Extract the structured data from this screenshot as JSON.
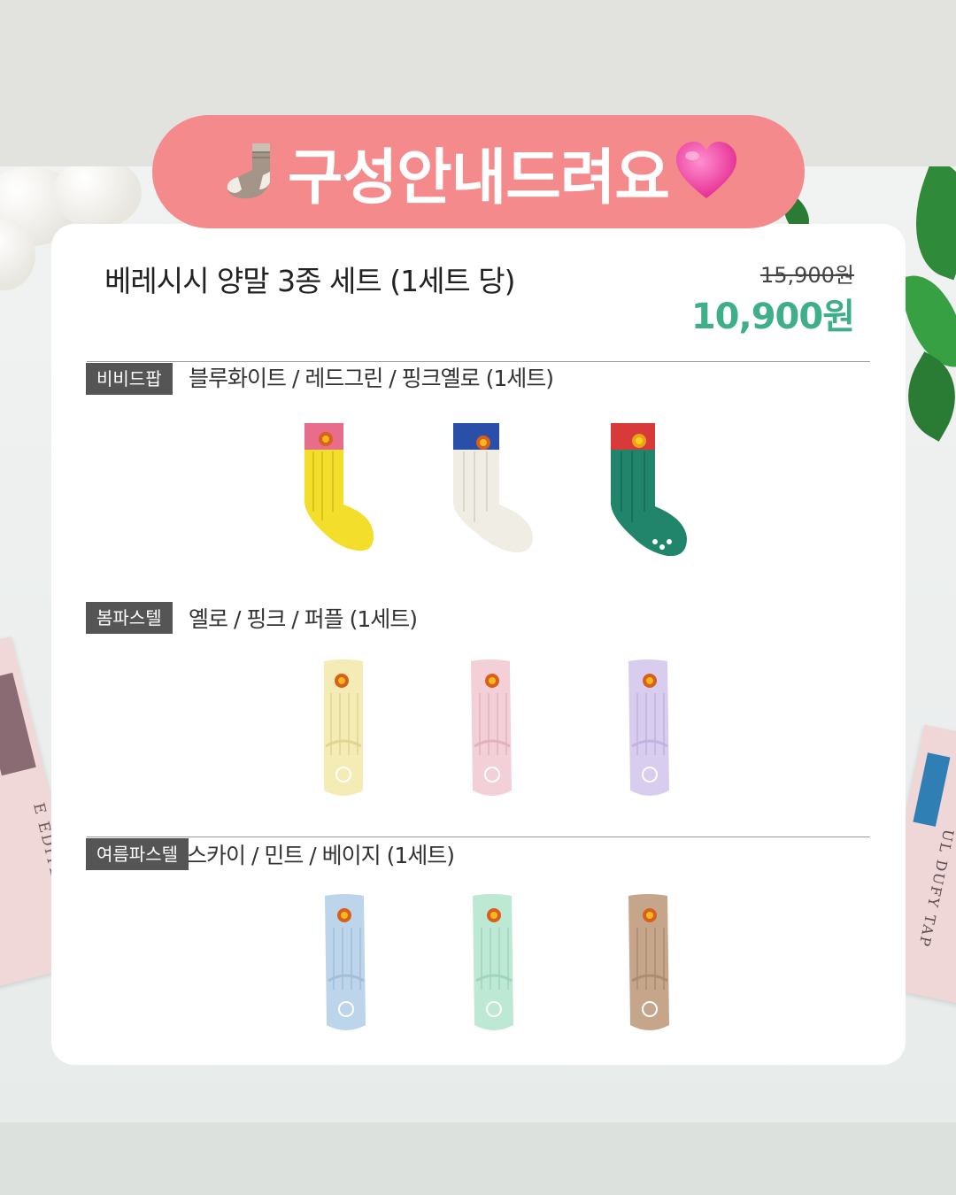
{
  "banner": {
    "title": "구성안내드려요",
    "left_emoji": "sock-icon",
    "right_emoji": "pink-heart-icon"
  },
  "product": {
    "title": "베레시시 양말 3종 세트 (1세트 당)",
    "original_price": "15,900원",
    "sale_price": "10,900원"
  },
  "colors": {
    "banner": "#f58a8c",
    "sale_price": "#3fae8a",
    "badge": "#555555"
  },
  "sections": [
    {
      "badge": "비비드팝",
      "description": "블루화이트 / 레드그린 / 핑크옐로 (1세트)",
      "socks": [
        {
          "name": "pink-yellow",
          "cuff": "#e86d8a",
          "body": "#f2de2b"
        },
        {
          "name": "blue-white",
          "cuff": "#2a4fa8",
          "body": "#efede4"
        },
        {
          "name": "red-green",
          "cuff": "#d83a3a",
          "body": "#20856b"
        }
      ]
    },
    {
      "badge": "봄파스텔",
      "description": "옐로 / 핑크 / 퍼플 (1세트)",
      "socks": [
        {
          "name": "yellow",
          "body": "#f5ebb5"
        },
        {
          "name": "pink",
          "body": "#f3cfd8"
        },
        {
          "name": "purple",
          "body": "#d9cdef"
        }
      ]
    },
    {
      "badge": "여름파스텔",
      "description": "스카이 / 민트 / 베이지 (1세트)",
      "socks": [
        {
          "name": "sky",
          "body": "#bcd5ea"
        },
        {
          "name": "mint",
          "body": "#bde8d3"
        },
        {
          "name": "beige",
          "body": "#c6a68b"
        }
      ]
    }
  ],
  "background": {
    "book_left_text": "E ÉDITEUR",
    "book_right_text": "UL DUFY TAP"
  }
}
